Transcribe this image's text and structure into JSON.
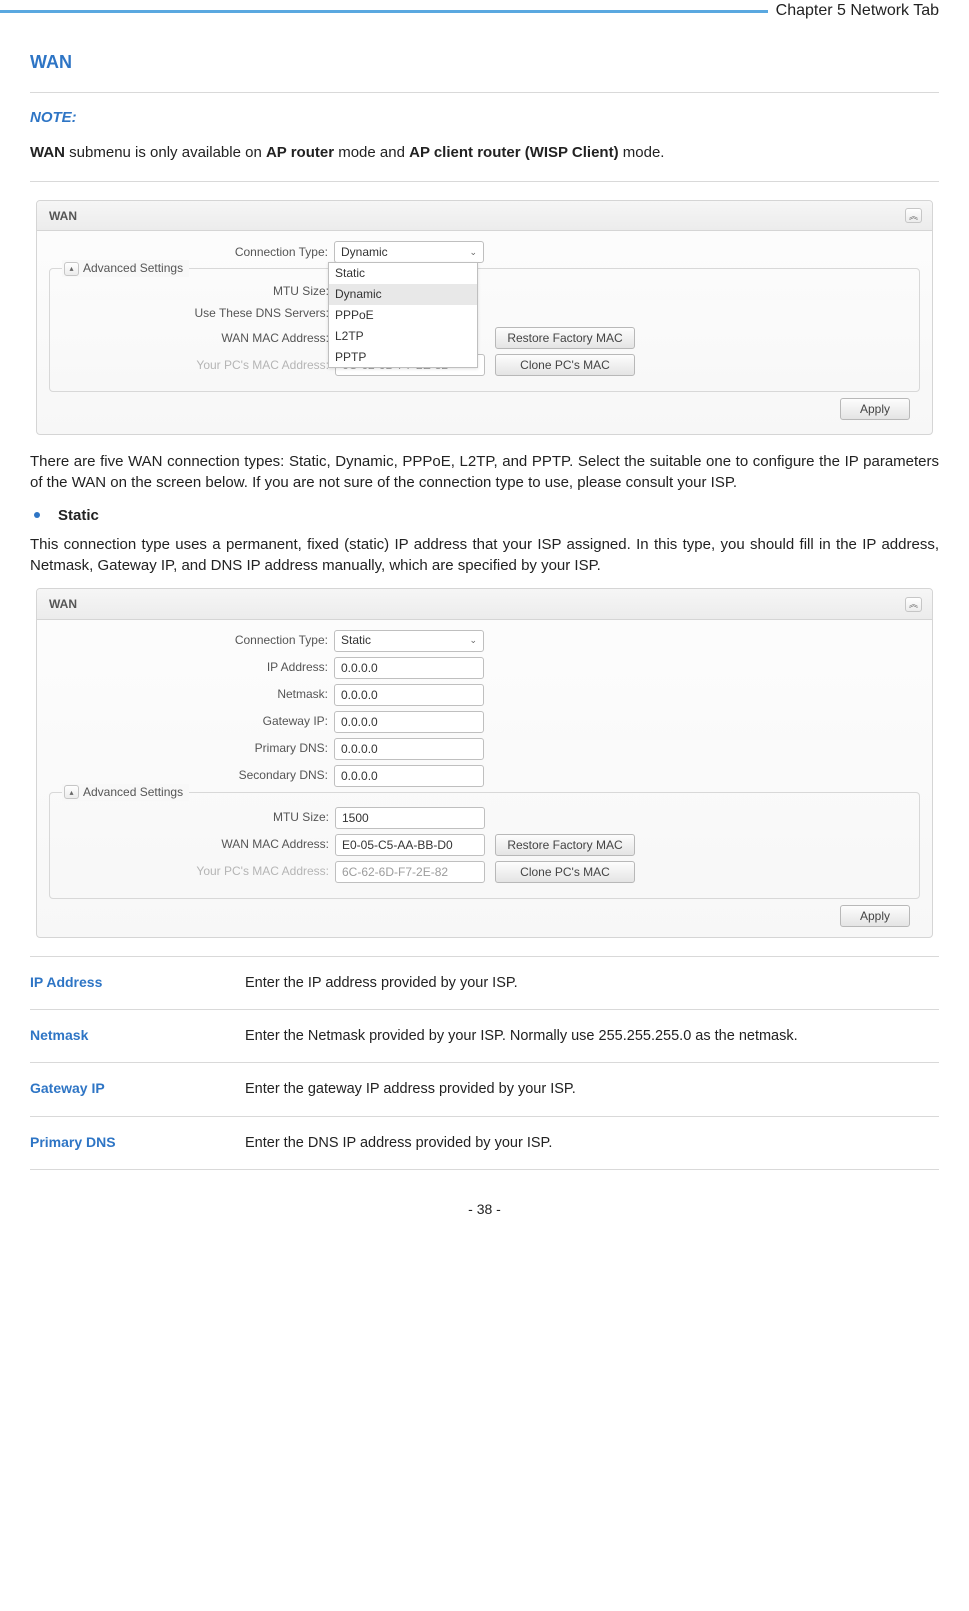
{
  "header": {
    "chapter": "Chapter 5 Network Tab"
  },
  "section": {
    "title": "WAN"
  },
  "note": {
    "label": "NOTE:",
    "text_parts": [
      "WAN",
      " submenu is only available on ",
      "AP router",
      " mode and ",
      "AP client router (WISP Client)",
      " mode."
    ]
  },
  "panel1": {
    "title": "WAN",
    "collapse_glyph": "︽",
    "conn_type_label": "Connection Type:",
    "conn_type_value": "Dynamic",
    "dropdown": [
      "Static",
      "Dynamic",
      "PPPoE",
      "L2TP",
      "PPTP"
    ],
    "adv_legend": "Advanced Settings",
    "adv_glyph": "▴",
    "mtu_label": "MTU Size:",
    "dns_label": "Use These DNS Servers:",
    "wan_mac_label": "WAN MAC Address:",
    "pc_mac_label": "Your PC's MAC Address:",
    "pc_mac_value": "6C-62-6D-F7-2E-82",
    "restore_btn": "Restore Factory MAC",
    "clone_btn": "Clone PC's MAC",
    "apply_btn": "Apply"
  },
  "intro_para": "There are five WAN connection types: Static, Dynamic, PPPoE, L2TP, and PPTP. Select the suitable one to configure the IP parameters of the WAN on the screen below. If you are not sure of the connection type to use, please consult your ISP.",
  "static": {
    "bullet": "Static",
    "para": "This connection type uses a permanent, fixed (static) IP address that your ISP assigned. In this type, you should fill in the IP address, Netmask, Gateway IP, and DNS IP address manually, which are specified by your ISP."
  },
  "panel2": {
    "title": "WAN",
    "collapse_glyph": "︽",
    "conn_type_label": "Connection Type:",
    "conn_type_value": "Static",
    "ip_label": "IP Address:",
    "ip_val": "0.0.0.0",
    "nm_label": "Netmask:",
    "nm_val": "0.0.0.0",
    "gw_label": "Gateway IP:",
    "gw_val": "0.0.0.0",
    "pdns_label": "Primary DNS:",
    "pdns_val": "0.0.0.0",
    "sdns_label": "Secondary DNS:",
    "sdns_val": "0.0.0.0",
    "adv_legend": "Advanced Settings",
    "adv_glyph": "▴",
    "mtu_label": "MTU Size:",
    "mtu_val": "1500",
    "wan_mac_label": "WAN MAC Address:",
    "wan_mac_val": "E0-05-C5-AA-BB-D0",
    "pc_mac_label": "Your PC's MAC Address:",
    "pc_mac_val": "6C-62-6D-F7-2E-82",
    "restore_btn": "Restore Factory MAC",
    "clone_btn": "Clone PC's MAC",
    "apply_btn": "Apply"
  },
  "definitions": [
    {
      "term": "IP Address",
      "desc": "Enter the IP address provided by your ISP."
    },
    {
      "term": "Netmask",
      "desc": "Enter the Netmask provided by your ISP. Normally use 255.255.255.0 as the netmask."
    },
    {
      "term": "Gateway IP",
      "desc": "Enter the gateway IP address provided by your ISP."
    },
    {
      "term": "Primary DNS",
      "desc": "Enter the DNS IP address provided by your ISP."
    }
  ],
  "page_number": "- 38 -"
}
